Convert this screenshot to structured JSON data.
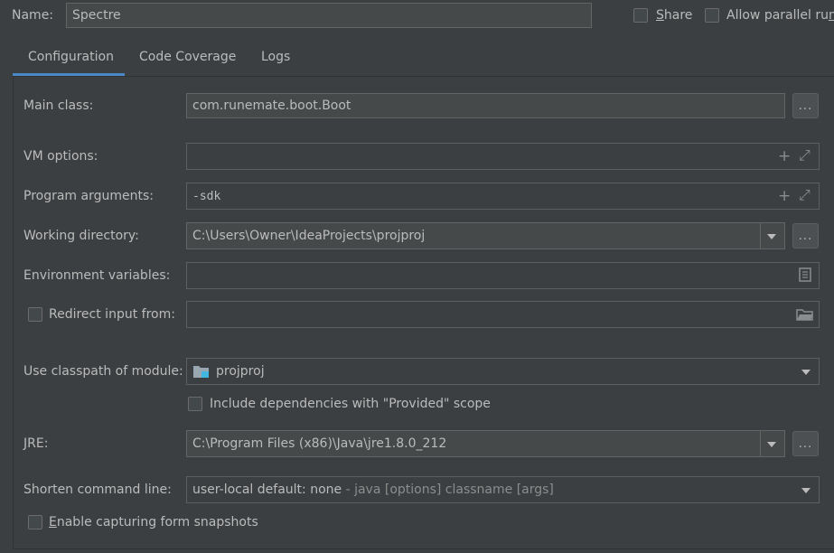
{
  "header": {
    "name_label": "Name:",
    "name_value": "Spectre",
    "share_label": "Share",
    "share_mnemonic": "S",
    "share_rest": "hare",
    "parallel_label": "Allow parallel run",
    "parallel_shown": "Allow parallel ru",
    "parallel_mnemonic": "n"
  },
  "tabs": [
    {
      "label": "Configuration",
      "active": true
    },
    {
      "label": "Code Coverage",
      "active": false
    },
    {
      "label": "Logs",
      "active": false
    }
  ],
  "form": {
    "main_class": {
      "label": "Main class:",
      "value": "com.runemate.boot.Boot",
      "browse_label": "..."
    },
    "vm_options": {
      "label": "VM options:",
      "value": ""
    },
    "program_arguments": {
      "label": "Program arguments:",
      "value": "-sdk"
    },
    "working_directory": {
      "label": "Working directory:",
      "value": "C:\\Users\\Owner\\IdeaProjects\\projproj",
      "browse_label": "..."
    },
    "environment_variables": {
      "label": "Environment variables:",
      "value": ""
    },
    "redirect_input": {
      "label": "Redirect input from:",
      "checked": false,
      "value": ""
    },
    "classpath_module": {
      "label": "Use classpath of module:",
      "value": "projproj",
      "icon": "module-folder-icon"
    },
    "include_provided": {
      "label": "Include dependencies with \"Provided\" scope",
      "checked": false
    },
    "jre": {
      "label": "JRE:",
      "value": "C:\\Program Files (x86)\\Java\\jre1.8.0_212",
      "browse_label": "..."
    },
    "shorten_command_line": {
      "label": "Shorten command line:",
      "value": "user-local default: none",
      "hint": " - java [options] classname [args]"
    },
    "capture_snapshots": {
      "label": "Enable capturing form snapshots",
      "mnemonic": "E",
      "rest": "nable capturing form snapshots",
      "checked": false
    }
  },
  "colors": {
    "background": "#3c3f41",
    "field": "#45494a",
    "accent": "#4a88c7",
    "text": "#bbbbbb"
  }
}
